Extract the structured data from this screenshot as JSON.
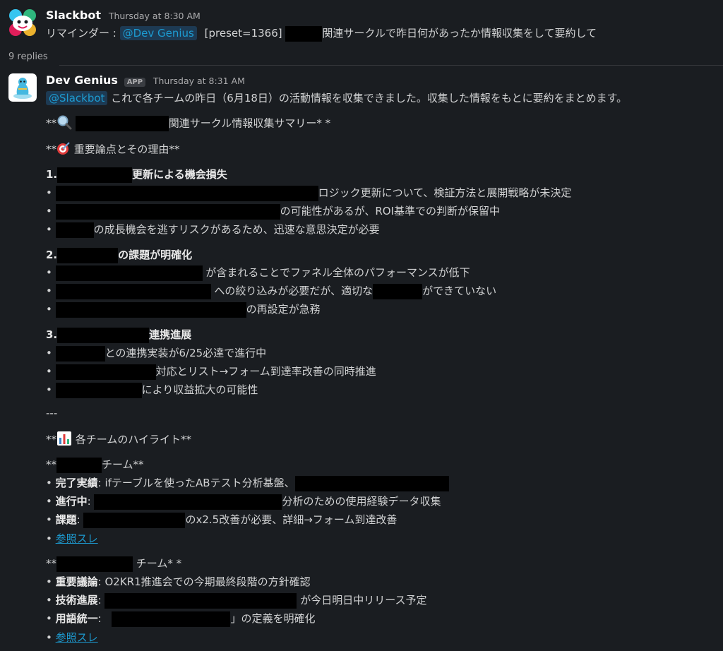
{
  "message1": {
    "author": "Slackbot",
    "time": "Thursday at 8:30 AM",
    "prefix": "リマインダー : ",
    "mention": "@Dev Genius",
    "preset": "[preset=1366]",
    "text_after": "関連サークルで昨日何があったか情報収集をして要約して"
  },
  "replies": "9 replies",
  "message2": {
    "author": "Dev Genius",
    "badge": "APP",
    "time": "Thursday at 8:31 AM",
    "mention": "@Slackbot",
    "intro": " これで各チームの昨日（6月18日）の活動情報を収集できました。収集した情報をもとに要約をまとめます。",
    "summary_title_prefix": "**",
    "summary_title_suffix": "関連サークル情報収集サマリー* *",
    "issues_heading_prefix": "**",
    "issues_heading_text": " 重要論点とその理由**",
    "sections": [
      {
        "number": "1.",
        "title_tail": "更新による機会損失",
        "bullets": [
          "ロジック更新について、検証方法と展開戦略が未決定",
          "の可能性があるが、ROI基準での判断が保留中",
          "の成長機会を逃すリスクがあるため、迅速な意思決定が必要"
        ]
      },
      {
        "number": "2.",
        "title_tail": "の課題が明確化",
        "bullets": [
          " が含まれることでファネル全体のパフォーマンスが低下",
          " への絞り込みが必要だが、適切な",
          "ができていない",
          "の再設定が急務"
        ]
      },
      {
        "number": "3.",
        "title_tail": "連携進展",
        "bullets": [
          "との連携実装が6/25必達で進行中",
          "対応とリスト→フォーム到達率改善の同時推進",
          "により収益拡大の可能性"
        ]
      }
    ],
    "separator": "---",
    "highlights_prefix": "**",
    "highlights_text": " 各チームのハイライト**",
    "team1": {
      "heading_prefix": "**",
      "heading_suffix": "チーム**",
      "done_label": "完了実績",
      "done_text": ": ifテーブルを使ったABテスト分析基盤、",
      "progress_label": "進行中",
      "progress_text": "分析のための使用経験データ収集",
      "issue_label": "課題",
      "issue_text": "のx2.5改善が必要、詳細→フォーム到達改善",
      "link": "参照スレ"
    },
    "team2": {
      "heading_prefix": "**",
      "heading_suffix": " チーム*  *",
      "discussion_label": "重要議論",
      "discussion_text": ": O2KR1推進会での今期最終段階の方針確認",
      "tech_label": "技術進展",
      "tech_text": " が今日明日中リリース予定",
      "term_label": "用語統一",
      "term_text": "」の定義を明確化",
      "link": "参照スレ"
    }
  },
  "colors": {
    "background": "#1a1d21",
    "text": "#d1d2d3",
    "link": "#1d9bd1",
    "mention_bg": "#1d3a53"
  }
}
